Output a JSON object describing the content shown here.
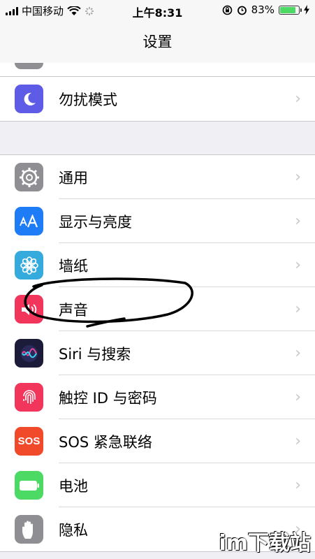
{
  "status_bar": {
    "carrier": "中国移动",
    "time": "上午8:31",
    "battery_percent": "83%",
    "battery_level": 0.83
  },
  "nav": {
    "title": "设置"
  },
  "groups": [
    {
      "items": [
        {
          "label": "勿扰模式",
          "icon": "moon-icon",
          "color": "#5e5ce6"
        }
      ]
    },
    {
      "items": [
        {
          "label": "通用",
          "icon": "gear-icon",
          "color": "#8e8e93"
        },
        {
          "label": "显示与亮度",
          "icon": "aa-icon",
          "color": "#1e7cf6"
        },
        {
          "label": "墙纸",
          "icon": "flower-icon",
          "color": "#35aadc"
        },
        {
          "label": "声音",
          "icon": "speaker-icon",
          "color": "#f2355b"
        },
        {
          "label": "Siri 与搜索",
          "icon": "siri-icon",
          "color": "#1c1c3a"
        },
        {
          "label": "触控 ID 与密码",
          "icon": "fingerprint-icon",
          "color": "#f2355b"
        },
        {
          "label": "SOS 紧急联络",
          "icon": "sos-icon",
          "color": "#f04a2a",
          "icon_text": "SOS"
        },
        {
          "label": "电池",
          "icon": "battery-icon",
          "color": "#4cd964"
        },
        {
          "label": "隐私",
          "icon": "hand-icon",
          "color": "#8e8e93"
        }
      ]
    }
  ],
  "watermark": "im下载站"
}
